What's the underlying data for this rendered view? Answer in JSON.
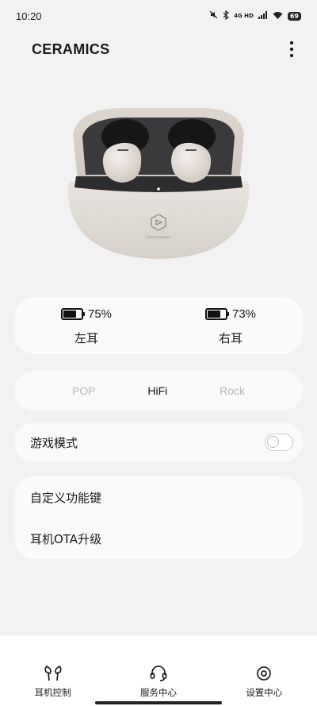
{
  "status_bar": {
    "time": "10:20",
    "network": "4G HD",
    "battery": "69",
    "icons": [
      "mute-icon",
      "bluetooth-icon",
      "signal-icon",
      "wifi-icon",
      "battery-icon"
    ]
  },
  "header": {
    "title": "CERAMICS",
    "menu_icon": "more-vertical-icon"
  },
  "product": {
    "brand_text": "EVAI CERAMICS"
  },
  "battery": {
    "left": {
      "percent_label": "75%",
      "level": 0.75,
      "label": "左耳"
    },
    "right": {
      "percent_label": "73%",
      "level": 0.73,
      "label": "右耳"
    }
  },
  "eq": {
    "options": [
      "POP",
      "HiFi",
      "Rock"
    ],
    "selected": "HiFi"
  },
  "game_mode": {
    "label": "游戏模式",
    "enabled": false
  },
  "settings": {
    "items": [
      "自定义功能键",
      "耳机OTA升级"
    ]
  },
  "bottom_nav": {
    "items": [
      {
        "label": "耳机控制",
        "icon": "earbuds-icon"
      },
      {
        "label": "服务中心",
        "icon": "headset-service-icon"
      },
      {
        "label": "设置中心",
        "icon": "settings-center-icon"
      }
    ]
  },
  "colors": {
    "background": "#f2f2f2",
    "card": "#fafafa",
    "inactive_text": "#b8b8b8",
    "text": "#111111"
  }
}
